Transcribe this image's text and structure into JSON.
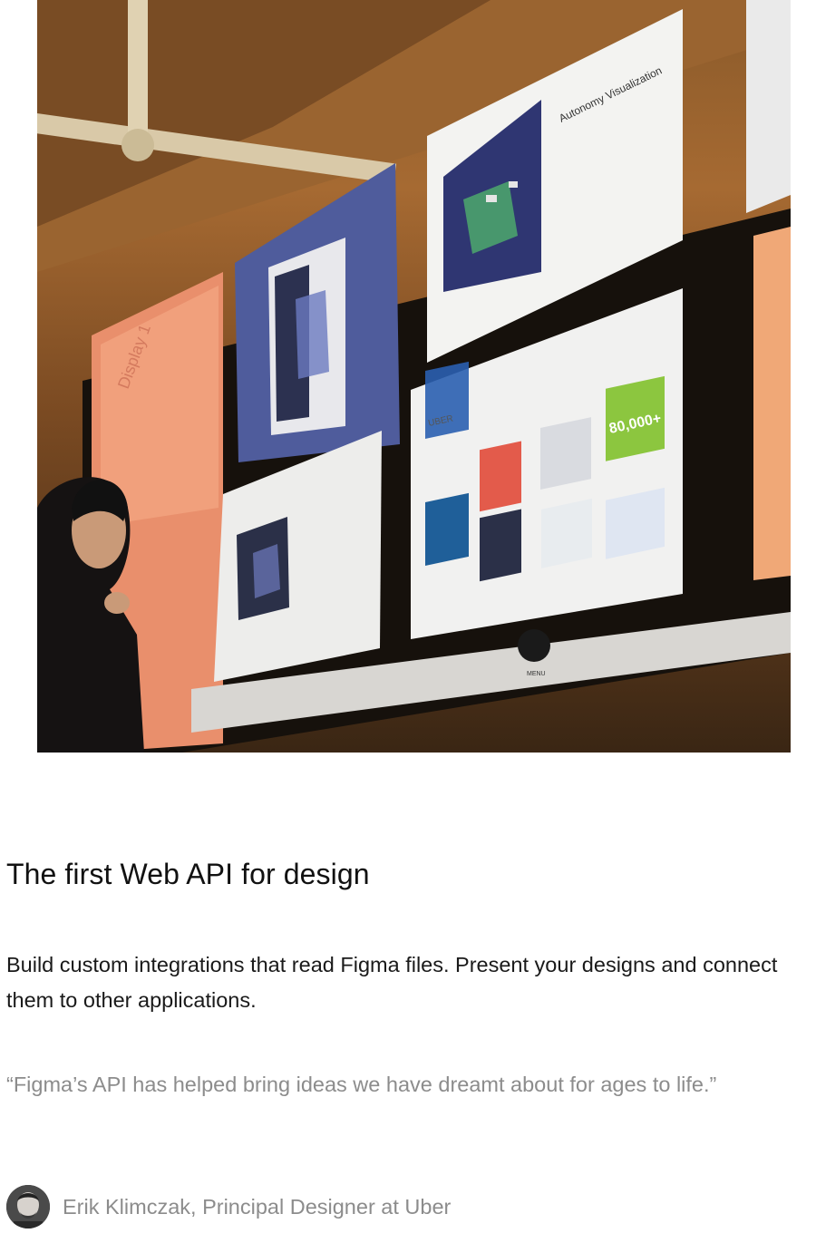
{
  "hero": {
    "image_name": "photo-person-viewing-wall-of-screens",
    "screen_texts": {
      "autonomy_title": "Autonomy Visualization",
      "uber_label": "UBER",
      "stat_badge": "80,000+",
      "display_label": "Display 1",
      "menu_label": "MENU"
    }
  },
  "content": {
    "headline": "The first Web API for design",
    "body": "Build custom integrations that read Figma files. Present your designs and connect them to other applications.",
    "quote": "“Figma’s API has helped bring ideas we have dreamt about for ages to life.”",
    "attribution": "Erik Klimczak, Principal Designer at Uber"
  },
  "colors": {
    "headline": "#111111",
    "body": "#1a1a1a",
    "muted": "#8c8c8c"
  }
}
